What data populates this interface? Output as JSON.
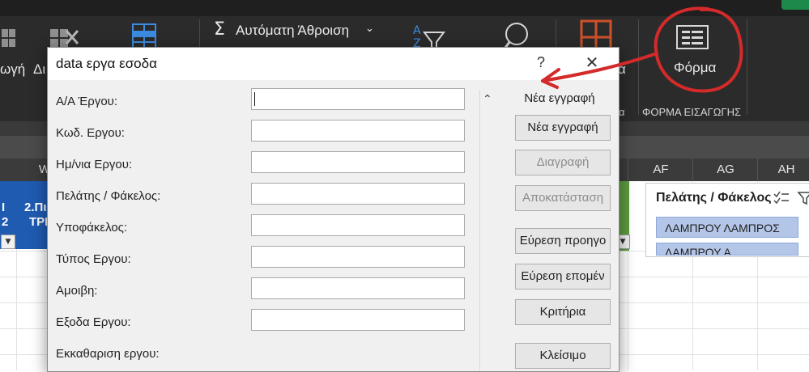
{
  "ribbon": {
    "partial_left_1": "ωγή",
    "partial_left_2": "Δι",
    "autosum_label": "Αυτόματη Άθροιση",
    "partial_a": "α",
    "forma_button": "Φόρμα",
    "group_label_left": "α",
    "group_label_forma": "ΦΟΡΜΑ ΕΙΣΑΓΩΓΗΣ"
  },
  "grid": {
    "column_headers": [
      {
        "label": "W"
      },
      {
        "label": "AF"
      },
      {
        "label": "AG"
      },
      {
        "label": "AH"
      }
    ],
    "left_header_fragment_1": "Ι",
    "left_header_fragment_2": "2",
    "left_header_fragment_3": "2.Πι",
    "left_header_fragment_4": "ΤΡΙ"
  },
  "slicer": {
    "title": "Πελάτης / Φάκελος",
    "items": [
      "ΛΑΜΠΡΟΥ ΛΑΜΠΡΟΣ",
      "ΛΑΜΠΡΟΥ Α"
    ]
  },
  "dialog": {
    "title": "data εργα εσοδα",
    "help": "?",
    "close": "✕",
    "record_status": "Νέα εγγραφή",
    "fields": [
      {
        "label": "Α/Α Έργου:",
        "value": ""
      },
      {
        "label": "Κωδ. Εργου:",
        "value": ""
      },
      {
        "label": "Ημ/νια Εργου:",
        "value": ""
      },
      {
        "label": "Πελάτης / Φάκελος:",
        "value": ""
      },
      {
        "label": "Υποφάκελος:",
        "value": ""
      },
      {
        "label": "Τύπος Εργου:",
        "value": ""
      },
      {
        "label": "Αμοιβη:",
        "value": ""
      },
      {
        "label": "Εξοδα Εργου:",
        "value": ""
      },
      {
        "label": "Εκκαθαριση εργου:"
      }
    ],
    "buttons": {
      "new": "Νέα εγγραφή",
      "delete": "Διαγραφή",
      "restore": "Αποκατάσταση",
      "find_prev": "Εύρεση προηγο",
      "find_next": "Εύρεση επομέν",
      "criteria": "Κριτήρια",
      "close": "Κλείσιμο"
    }
  },
  "colors": {
    "ribbon_bg": "#2b2b2b",
    "annotation": "#d42a2a",
    "header_blue": "#1f5bb0",
    "slicer_item": "#b4c6e7"
  }
}
